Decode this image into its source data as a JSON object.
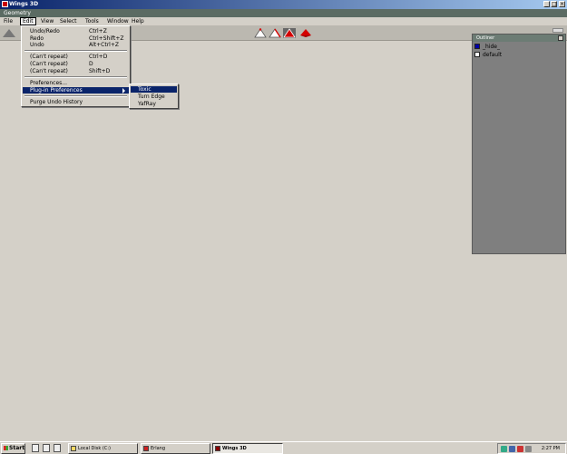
{
  "window": {
    "title": "Wings 3D",
    "buttons": [
      "_",
      "□",
      "×"
    ]
  },
  "geometry_label": "Geometry",
  "menubar": [
    "File",
    "Edit",
    "View",
    "Select",
    "Tools",
    "Window",
    "Help"
  ],
  "active_menu": "Edit",
  "edit_menu": {
    "items": [
      {
        "label": "Undo/Redo",
        "shortcut": "Ctrl+Z"
      },
      {
        "label": "Redo",
        "shortcut": "Ctrl+Shift+Z"
      },
      {
        "label": "Undo",
        "shortcut": "Alt+Ctrl+Z"
      },
      {
        "label": "(Can't repeat)",
        "shortcut": "Ctrl+D"
      },
      {
        "label": "(Can't repeat)",
        "shortcut": "D"
      },
      {
        "label": "(Can't repeat)",
        "shortcut": "Shift+D"
      },
      {
        "label": "Preferences...",
        "shortcut": ""
      },
      {
        "label": "Plug-in Preferences",
        "shortcut": ""
      },
      {
        "label": "Purge Undo History",
        "shortcut": ""
      }
    ]
  },
  "submenu": {
    "items": [
      "Toxic",
      "Turn Edge",
      "YafRay"
    ]
  },
  "outliner": {
    "title": "Outliner",
    "items": [
      {
        "label": "_hide_",
        "color": "#0000a8"
      },
      {
        "label": "default",
        "color": "#ffffff"
      }
    ]
  },
  "taskbar": {
    "start": "Start",
    "tasks": [
      "Local Disk (C:)",
      "Erlang",
      "Wings 3D"
    ],
    "active_task": "Wings 3D",
    "clock": "2:27 PM"
  },
  "colors": {
    "title_start": "#0a246a",
    "menu_highlight": "#0a246a",
    "geometry_bar": "#5b6b63",
    "selection_red": "#d40000"
  }
}
